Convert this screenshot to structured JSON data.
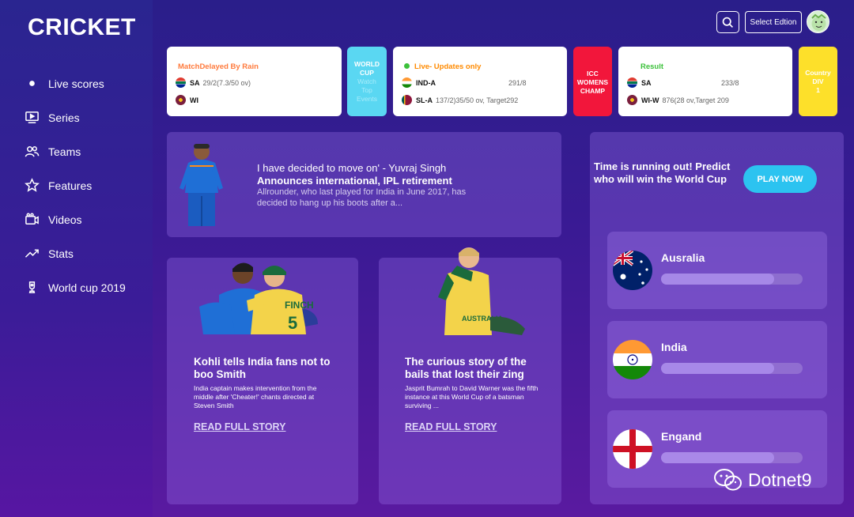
{
  "app": {
    "logo": "CRICKET"
  },
  "sidebar": {
    "items": [
      {
        "label": "Live scores",
        "icon": "dot-icon"
      },
      {
        "label": "Series",
        "icon": "play-screen-icon"
      },
      {
        "label": "Teams",
        "icon": "users-icon"
      },
      {
        "label": "Features",
        "icon": "star-icon"
      },
      {
        "label": "Videos",
        "icon": "video-icon"
      },
      {
        "label": "Stats",
        "icon": "trending-icon"
      },
      {
        "label": "World cup 2019",
        "icon": "trophy-icon"
      }
    ]
  },
  "header": {
    "edition_label": "Select Edtion"
  },
  "scores": {
    "card1": {
      "status": "MatchDelayed By Rain",
      "status_color": "#ff7a3c",
      "team1": "SA",
      "team1_score": "29/2(7.3/50 ov)",
      "team2": "WI"
    },
    "tile1": {
      "line1": "WORLD",
      "line2": "CUP",
      "line3": "Watch",
      "line4": "Top",
      "line5": "Events"
    },
    "card2": {
      "status": "Live- Updates only",
      "status_color": "#ff8a00",
      "team1": "IND-A",
      "team1_score": "291/8",
      "team2": "SL-A",
      "team2_score": "137/2)35/50 ov, Target292"
    },
    "tile2": {
      "line1": "ICC",
      "line2": "WOMENS",
      "line3": "CHAMP"
    },
    "card3": {
      "status": "Result",
      "status_color": "#3cc13b",
      "team1": "SA",
      "team1_score": "233/8",
      "team2": "WI-W",
      "team2_score": "876(28 ov,Target 209"
    },
    "tile3": {
      "line1": "Country",
      "line2": "DIV",
      "line3": "1"
    }
  },
  "headline": {
    "title": "I have decided to move on' - Yuvraj Singh",
    "subtitle": "Announces international, IPL retirement",
    "desc": "Allrounder, who last played for India in June 2017, has decided to hang up his boots after a..."
  },
  "stories": [
    {
      "title": "Kohli tells India fans not to boo Smith",
      "desc": "India captain makes intervention from the middle after 'Cheater!' chants directed at Steven Smith",
      "link": "READ FULL STORY"
    },
    {
      "title": "The curious story of the bails that lost their zing",
      "desc": "Jasprit Bumrah to David Warner was the fifth instance at this World Cup of a batsman surviving ...",
      "link": "READ FULL STORY"
    }
  ],
  "poll": {
    "prompt": "Time is running out! Predict who will win the World Cup",
    "play_label": "PLAY NOW",
    "options": [
      {
        "name": "Ausralia",
        "progress": 0.8
      },
      {
        "name": "India",
        "progress": 0.8
      },
      {
        "name": "Engand",
        "progress": 0.8
      }
    ]
  },
  "watermark": "Dotnet9"
}
